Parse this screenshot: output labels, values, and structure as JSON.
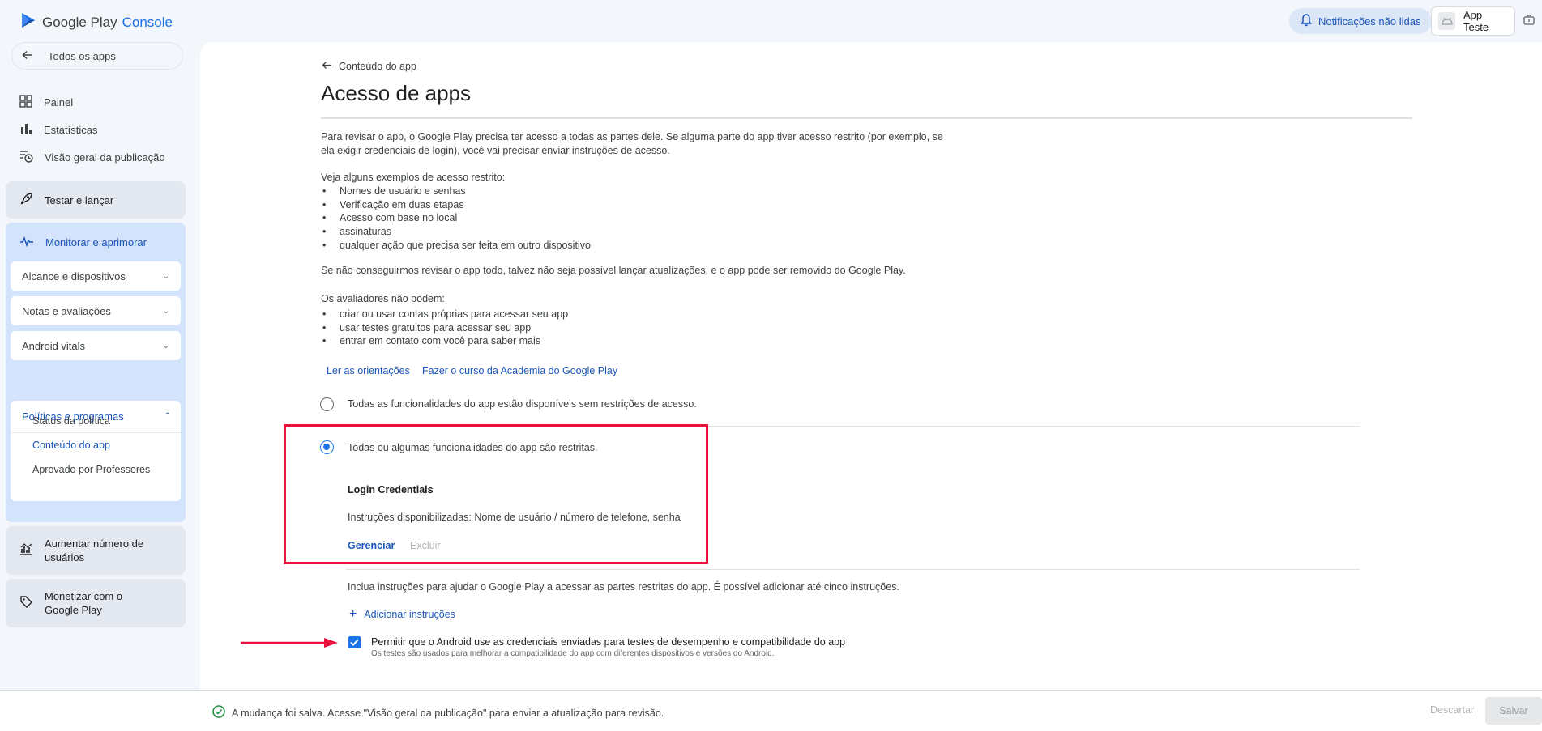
{
  "header": {
    "logo_google_play": "Google Play",
    "logo_console": "Console",
    "notifications_label": "Notificações não lidas",
    "app_name": "App Teste"
  },
  "sidebar": {
    "all_apps": "Todos os apps",
    "top_items": [
      {
        "label": "Painel",
        "icon": "dashboard-icon"
      },
      {
        "label": "Estatísticas",
        "icon": "bar-chart-icon"
      },
      {
        "label": "Visão geral da publicação",
        "icon": "publishing-overview-icon"
      }
    ],
    "test_release": "Testar e lançar",
    "monitor": {
      "label": "Monitorar e aprimorar",
      "subsections": [
        {
          "label": "Alcance e dispositivos"
        },
        {
          "label": "Notas e avaliações"
        },
        {
          "label": "Android vitals"
        }
      ],
      "policy": {
        "label": "Políticas e programas",
        "items": [
          "Status da política",
          "Conteúdo do app",
          "Aprovado por Professores"
        ]
      }
    },
    "grow_users": "Aumentar número de usuários",
    "monetize": "Monetizar com o Google Play"
  },
  "main": {
    "back_label": "Conteúdo do app",
    "title": "Acesso de apps",
    "intro_line1": "Para revisar o app, o Google Play precisa ter acesso a todas as partes dele. Se alguma parte do app tiver acesso restrito (por exemplo, se",
    "intro_line2": "ela exigir credenciais de login), você vai precisar enviar instruções de acesso.",
    "examples_heading": "Veja alguns exemplos de acesso restrito:",
    "examples": [
      "Nomes de usuário e senhas",
      "Verificação em duas etapas",
      "Acesso com base no local",
      "assinaturas",
      "qualquer ação que precisa ser feita em outro dispositivo"
    ],
    "warning": "Se não conseguirmos revisar o app todo, talvez não seja possível lançar atualizações, e o app pode ser removido do Google Play.",
    "reviewers_heading": "Os avaliadores não podem:",
    "reviewers_cannot": [
      "criar ou usar contas próprias para acessar seu app",
      "usar testes gratuitos para acessar seu app",
      "entrar em contato com você para saber mais"
    ],
    "link_guidelines": "Ler as orientações",
    "link_course": "Fazer o curso da Academia do Google Play",
    "option_all_available": "Todas as funcionalidades do app estão disponíveis sem restrições de acesso.",
    "option_restricted": "Todas ou algumas funcionalidades do app são restritas.",
    "credential_title": "Login Credentials",
    "credential_instructions": "Instruções disponibilizadas: Nome de usuário / número de telefone, senha",
    "manage": "Gerenciar",
    "delete": "Excluir",
    "include_instructions": "Inclua instruções para ajudar o Google Play a acessar as partes restritas do app. É possível adicionar até cinco instruções.",
    "add_instructions": "Adicionar instruções",
    "allow_android_label": "Permitir que o Android use as credenciais enviadas para testes de desempenho e compatibilidade do app",
    "allow_android_note": "Os testes são usados para melhorar a compatibilidade do app com diferentes dispositivos e versões do Android.",
    "allow_android_checked": true
  },
  "footer": {
    "saved_message": "A mudança foi salva. Acesse \"Visão geral da publicação\" para enviar a atualização para revisão.",
    "discard": "Descartar",
    "save": "Salvar"
  },
  "colors": {
    "accent": "#1a73e8",
    "annotation_red": "#e8123c",
    "success_green": "#1e8e3e"
  }
}
